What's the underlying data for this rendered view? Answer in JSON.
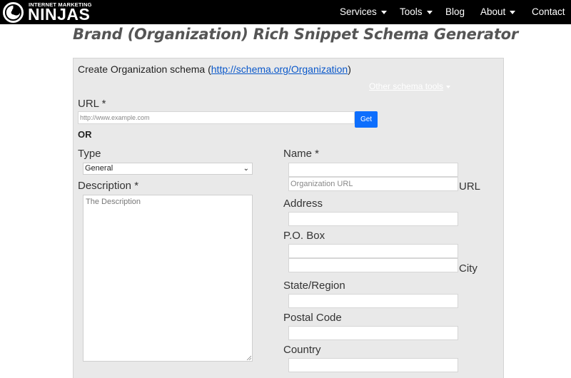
{
  "header": {
    "logo_top": "INTERNET MARKETING",
    "logo_main": "NINJAS",
    "nav": [
      {
        "label": "Services"
      },
      {
        "label": "Tools"
      },
      {
        "label": "Blog"
      },
      {
        "label": "About"
      },
      {
        "label": "Contact"
      }
    ]
  },
  "page_title": "Brand (Organization) Rich Snippet Schema Generator",
  "panel": {
    "heading_prefix": "Create Organization schema (",
    "heading_link": "http://schema.org/Organization",
    "heading_suffix": ")",
    "other_tools": "Other schema tools"
  },
  "form": {
    "url_label": "URL *",
    "url_placeholder": "http://www.example.com",
    "get_button": "Get",
    "or_text": "OR",
    "type_label": "Type",
    "type_selected": "General",
    "description_label": "Description *",
    "description_placeholder": "The Description",
    "name_label": "Name *",
    "org_url_placeholder": "Organization URL",
    "url_side_label": "URL",
    "address_label": "Address",
    "pobox_label": "P.O. Box",
    "city_label": "City",
    "state_label": "State/Region",
    "postal_label": "Postal Code",
    "country_label": "Country"
  },
  "colors": {
    "nav_bg": "#000000",
    "panel_bg": "#e9e9e9",
    "button_blue": "#0d6efd",
    "link_blue": "#0a58ca"
  },
  "icons": [
    "ninja-logo-icon",
    "caret-down-icon",
    "chevron-down-icon",
    "resize-grip-icon"
  ]
}
